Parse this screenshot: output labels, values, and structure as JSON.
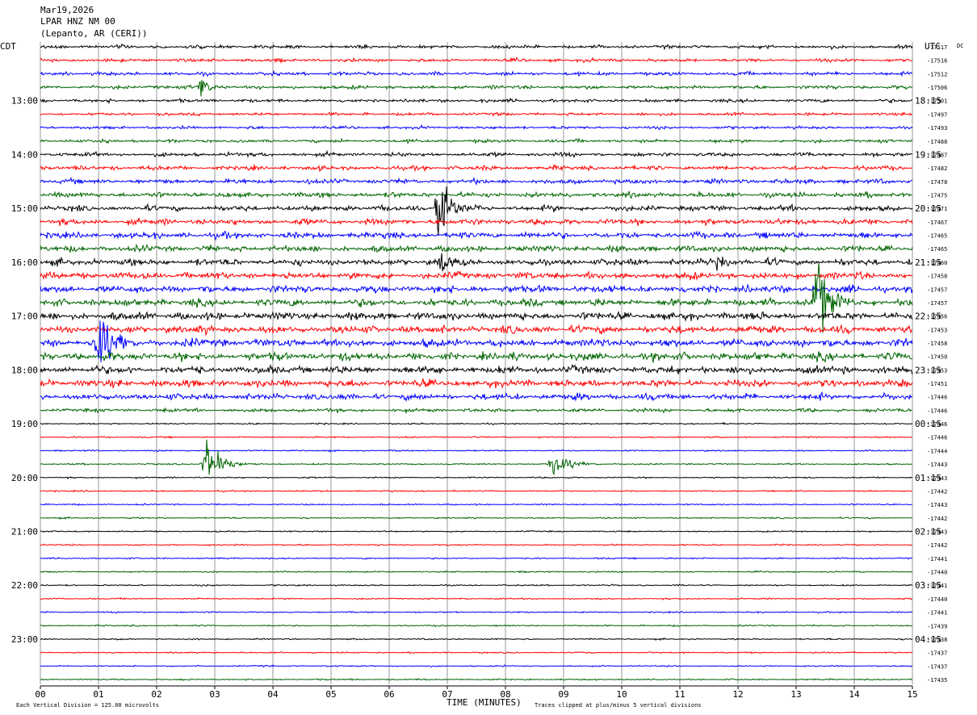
{
  "header": {
    "date": "Mar19,2026",
    "station": "LPAR HNZ NM 00",
    "location": "(Lepanto, AR (CERI))"
  },
  "chart_data": {
    "type": "line",
    "title": "",
    "xlabel": "TIME (MINUTES)",
    "xlim": [
      0,
      15
    ],
    "x_ticks": [
      "00",
      "01",
      "02",
      "03",
      "04",
      "05",
      "06",
      "07",
      "08",
      "09",
      "10",
      "11",
      "12",
      "13",
      "14",
      "15"
    ],
    "left_zone": "CDT",
    "right_zone": "UTC",
    "dc_label": "DC",
    "left_time_labels": [
      "13:00",
      "14:00",
      "15:00",
      "16:00",
      "17:00",
      "18:00",
      "19:00",
      "20:00",
      "21:00",
      "22:00",
      "23:00"
    ],
    "right_time_labels": [
      "18:15",
      "19:15",
      "20:15",
      "21:15",
      "22:15",
      "23:15",
      "00:15",
      "01:15",
      "02:15",
      "03:15",
      "04:15"
    ],
    "trace_minutes": 15,
    "traces_per_label": 4,
    "first_labeled_trace": 4,
    "trace_colors": [
      "#000000",
      "#ff0000",
      "#0000ff",
      "#006400"
    ],
    "dc_offsets": [
      -17517,
      -17516,
      -17512,
      -17506,
      -17501,
      -17497,
      -17493,
      -17488,
      -17487,
      -17482,
      -17478,
      -17475,
      -17471,
      -17467,
      -17465,
      -17465,
      -17460,
      -17458,
      -17457,
      -17457,
      -17456,
      -17453,
      -17458,
      -17450,
      -17453,
      -17451,
      -17446,
      -17446,
      -17446,
      -17446,
      -17444,
      -17443,
      -17443,
      -17442,
      -17443,
      -17442,
      -17443,
      -17442,
      -17441,
      -17440,
      -17441,
      -17440,
      -17441,
      -17439,
      -17438,
      -17437,
      -17437,
      -17435
    ],
    "trace_noise_level": [
      0.45,
      0.45,
      0.5,
      0.5,
      0.45,
      0.4,
      0.4,
      0.45,
      0.55,
      0.6,
      0.65,
      0.7,
      0.75,
      0.8,
      0.85,
      0.85,
      0.9,
      0.95,
      1.0,
      1.0,
      1.05,
      1.05,
      1.1,
      1.1,
      1.05,
      1.0,
      0.85,
      0.5,
      0.2,
      0.2,
      0.2,
      0.2,
      0.2,
      0.2,
      0.2,
      0.2,
      0.2,
      0.2,
      0.2,
      0.2,
      0.2,
      0.2,
      0.2,
      0.2,
      0.2,
      0.2,
      0.2,
      0.2
    ],
    "events": [
      {
        "trace": 3,
        "minute": 2.75,
        "amplitude": 18,
        "duration_min": 0.2
      },
      {
        "trace": 12,
        "minute": 6.85,
        "amplitude": 55,
        "duration_min": 0.3
      },
      {
        "trace": 16,
        "minute": 6.9,
        "amplitude": 20,
        "duration_min": 0.2
      },
      {
        "trace": 16,
        "minute": 11.65,
        "amplitude": 12,
        "duration_min": 0.2
      },
      {
        "trace": 19,
        "minute": 13.35,
        "amplitude": 50,
        "duration_min": 0.35
      },
      {
        "trace": 22,
        "minute": 1.0,
        "amplitude": 55,
        "duration_min": 0.35
      },
      {
        "trace": 31,
        "minute": 2.85,
        "amplitude": 28,
        "duration_min": 0.4
      },
      {
        "trace": 31,
        "minute": 8.8,
        "amplitude": 22,
        "duration_min": 0.4
      }
    ]
  },
  "footer": {
    "scale_note": "Each Vertical Division =  125.00 microvolts",
    "clip_note": "Traces clipped at plus/minus 5 vertical divisions"
  }
}
